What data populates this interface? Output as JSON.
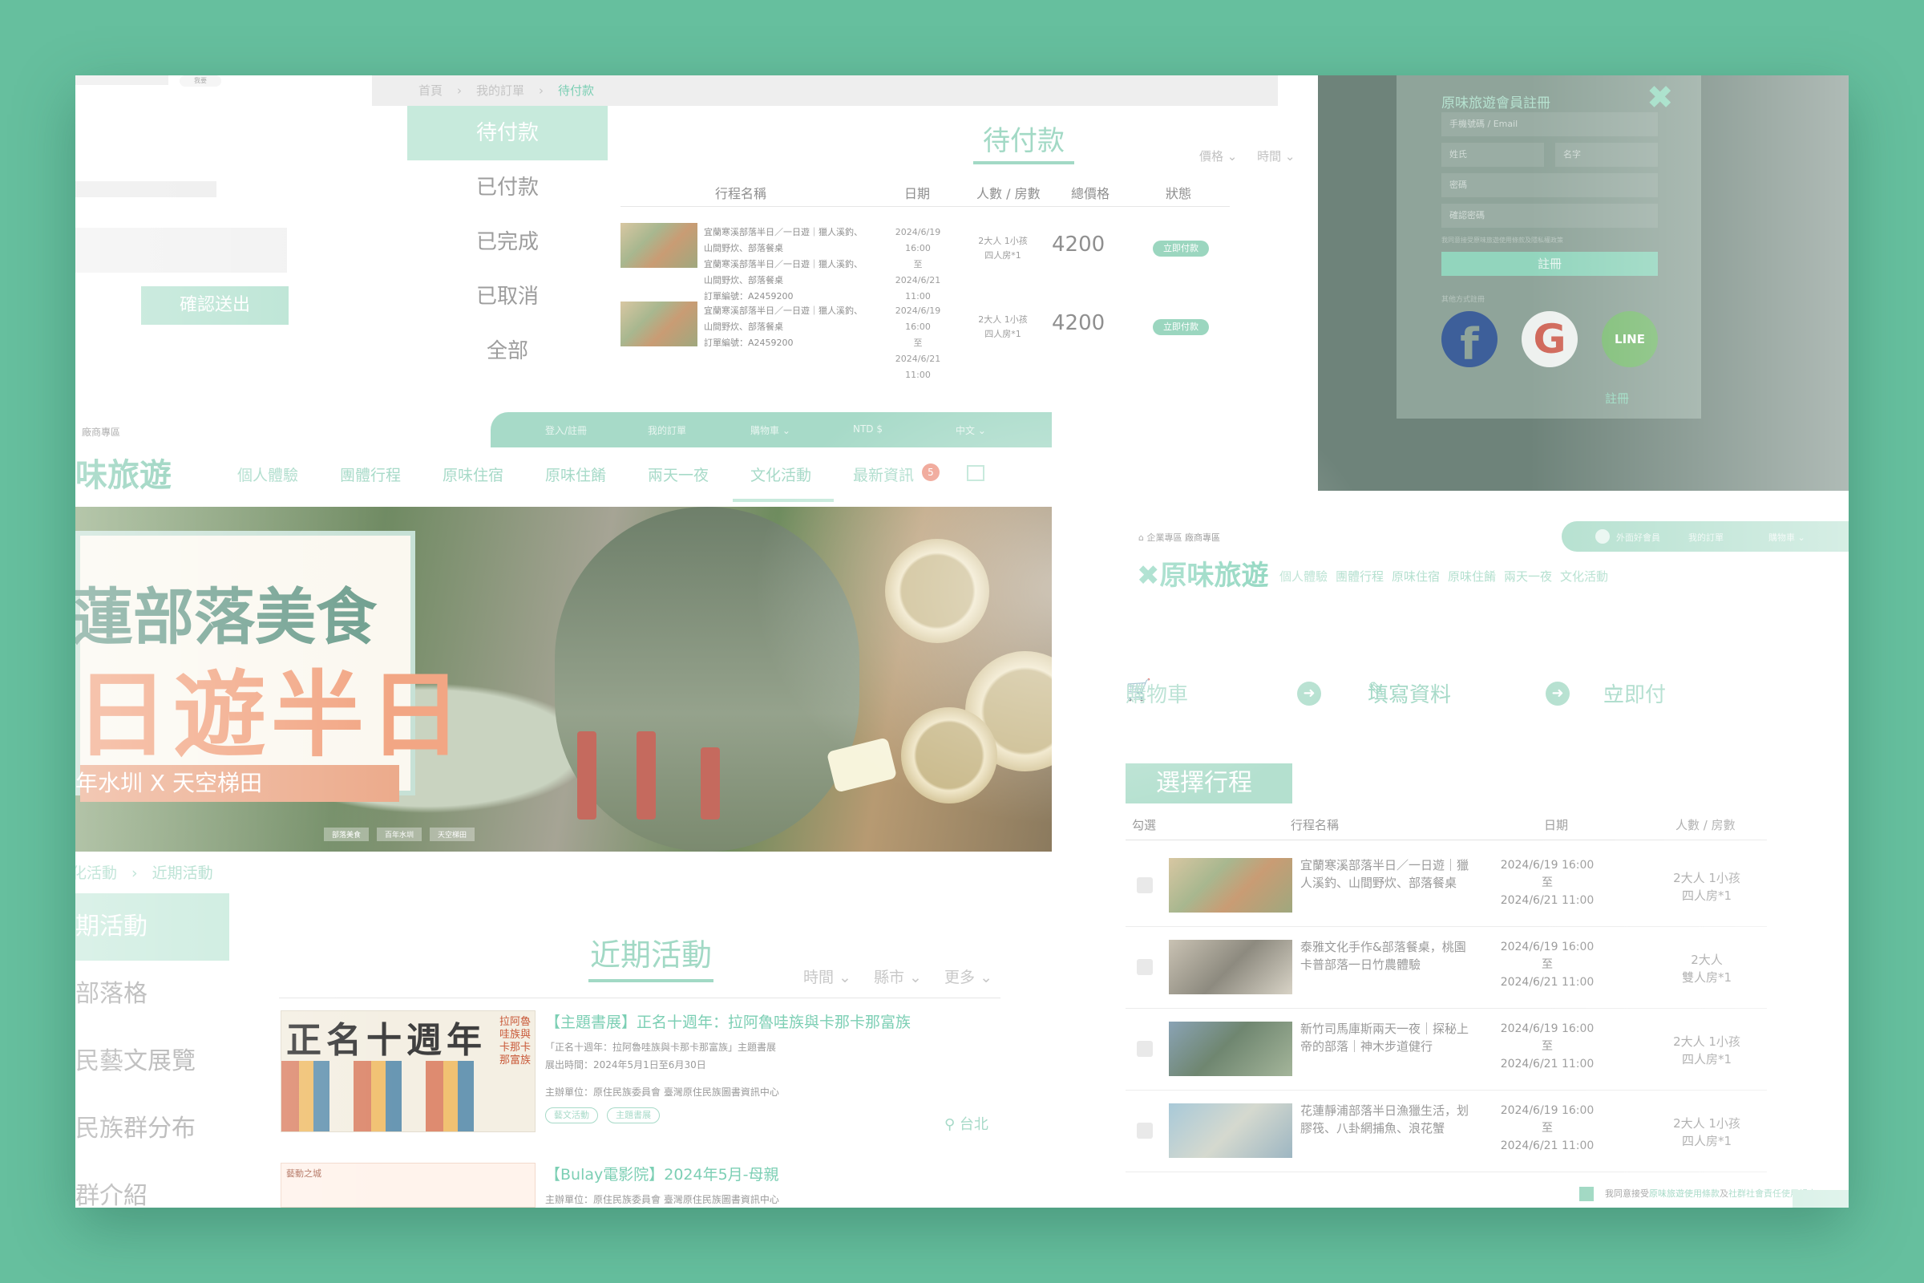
{
  "colors": {
    "background": "#66bf9e",
    "accent": "#7ccfb4",
    "accent_light": "#c7eadc",
    "hero_orange": "#f2a684"
  },
  "top_left": {
    "small_label": "我要",
    "confirm_button": "確認送出"
  },
  "orders": {
    "breadcrumb": [
      "首頁",
      "我的訂單",
      "待付款"
    ],
    "menu": [
      "待付款",
      "已付款",
      "已完成",
      "已取消",
      "全部"
    ],
    "title": "待付款",
    "filters": [
      "價格 ⌄",
      "時間 ⌄"
    ],
    "columns": [
      "行程名稱",
      "日期",
      "人數 / 房數",
      "總價格",
      "狀態"
    ],
    "rows": [
      {
        "desc1": "宜蘭寒溪部落半日／一日遊｜獵人溪釣、",
        "desc2": "山間野炊、部落餐桌",
        "desc3": "宜蘭寒溪部落半日／一日遊｜獵人溪釣、",
        "desc4": "山間野炊、部落餐桌",
        "order_no": "訂單編號：A2459200",
        "date_from": "2024/6/19 16:00",
        "date_to_word": "至",
        "date_to": "2024/6/21 11:00",
        "people": "2大人 1小孩",
        "rooms": "四人房*1",
        "price": "4200",
        "status": "立即付款"
      },
      {
        "desc1": "宜蘭寒溪部落半日／一日遊｜獵人溪釣、",
        "desc2": "山間野炊、部落餐桌",
        "order_no": "訂單編號：A2459200",
        "date_from": "2024/6/19 16:00",
        "date_to_word": "至",
        "date_to": "2024/6/21 11:00",
        "people": "2大人 1小孩",
        "rooms": "四人房*1",
        "price": "4200",
        "status": "立即付款"
      }
    ]
  },
  "register": {
    "title": "原味旅遊會員註冊",
    "close_icon": "✖",
    "fields": [
      "手機號碼 / Email",
      "姓氏",
      "名字",
      "密碼",
      "確認密碼"
    ],
    "terms": "我同意接受原味旅遊使用條款及隱私權政策",
    "submit": "註冊",
    "other_login": "其他方式註冊",
    "social": [
      "f",
      "G",
      "LINE"
    ],
    "bottom_link": "註冊"
  },
  "site": {
    "enterprise_link": "廠商專區",
    "brand": "原味旅遊",
    "topbar": [
      "登入/註冊",
      "我的訂單",
      "購物車 ⌄",
      "NTD $",
      "中文 ⌄"
    ],
    "nav": [
      "個人體驗",
      "團體行程",
      "原味住宿",
      "原味住餚",
      "兩天一夜",
      "文化活動",
      "最新資訊"
    ],
    "news_badge": "5"
  },
  "hero": {
    "line1": "花蓮部落美食",
    "line2": "一日遊半日",
    "ribbon": "百年水圳 X 天空梯田",
    "tags": [
      "部落美食",
      "百年水圳",
      "天空梯田"
    ]
  },
  "activities": {
    "breadcrumb": [
      "文化活動",
      "近期活動"
    ],
    "menu": [
      "近期活動",
      "原味部落格",
      "原民藝文展覽",
      "原住民族群分布",
      "族群介紹"
    ],
    "title": "近期活動",
    "filters": [
      "時間 ⌄",
      "縣市 ⌄",
      "更多 ⌄"
    ],
    "items": [
      {
        "thumb_title": "正名十週年",
        "thumb_side": "拉阿魯哇族與卡那卡那富族",
        "title": "【主題書展】正名十週年：拉阿魯哇族與卡那卡那富族",
        "subtitle": "「正名十週年：拉阿魯哇族與卡那卡那富族」主題書展",
        "period": "展出時間：2024年5月1日至6月30日",
        "organizer": "主辦單位：原住民族委員會 臺灣原住民族圖書資訊中心",
        "tags": [
          "藝文活動",
          "主題書展"
        ],
        "location": "台北"
      },
      {
        "thumb_text": "藝動之城",
        "title": "【Bulay電影院】2024年5月-母親",
        "organizer": "主辦單位：原住民族委員會 臺灣原住民族圖書資訊中心"
      }
    ]
  },
  "cart": {
    "crumb": "企業專區  廠商專區",
    "topbar": [
      "外面好會員",
      "我的訂單",
      "購物車 ⌄"
    ],
    "brand": "原味旅遊",
    "nav": [
      "個人體驗",
      "團體行程",
      "原味住宿",
      "原味住餚",
      "兩天一夜",
      "文化活動"
    ],
    "steps": [
      "購物車",
      "填寫資料",
      "立即付"
    ],
    "title": "選擇行程",
    "columns": [
      "勾選",
      "行程名稱",
      "日期",
      "人數 / 房數"
    ],
    "rows": [
      {
        "name": "宜蘭寒溪部落半日／一日遊｜獵人溪釣、山間野炊、部落餐桌",
        "from": "2024/6/19  16:00",
        "to_word": "至",
        "to": "2024/6/21  11:00",
        "people": "2大人  1小孩",
        "rooms": "四人房*1"
      },
      {
        "name": "泰雅文化手作&部落餐桌，桃園卡普部落一日竹農體驗",
        "from": "2024/6/19  16:00",
        "to_word": "至",
        "to": "2024/6/21  11:00",
        "people": "2大人",
        "rooms": "雙人房*1"
      },
      {
        "name": "新竹司馬庫斯兩天一夜｜探秘上帝的部落｜神木步道健行",
        "from": "2024/6/19  16:00",
        "to_word": "至",
        "to": "2024/6/21  11:00",
        "people": "2大人  1小孩",
        "rooms": "四人房*1"
      },
      {
        "name": "花蓮靜浦部落半日漁獵生活，划膠筏、八卦網捕魚、浪花蟹",
        "from": "2024/6/19  16:00",
        "to_word": "至",
        "to": "2024/6/21  11:00",
        "people": "2大人  1小孩",
        "rooms": "四人房*1"
      }
    ],
    "agree_prefix": "我同意接受",
    "agree_link1": "原味旅遊使用條款",
    "agree_mid": "及",
    "agree_link2": "社群社會責任使用規定"
  }
}
